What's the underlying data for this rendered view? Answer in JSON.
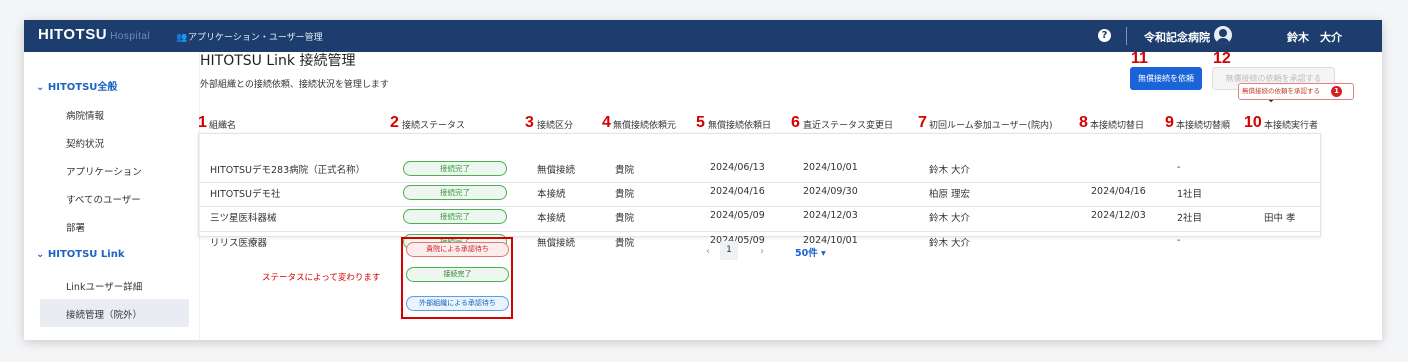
{
  "topbar": {
    "logo": "HITOTSU",
    "logo_sub": "Hospital",
    "nav_icon": "users-icon",
    "nav_label": "アプリケーション・ユーザー管理",
    "help": "?",
    "hospital": "令和記念病院",
    "user": "鈴木　大介"
  },
  "sidebar": {
    "section1": "HITOTSU全般",
    "items1": [
      "病院情報",
      "契約状況",
      "アプリケーション",
      "すべてのユーザー",
      "部署"
    ],
    "section2": "HITOTSU Link",
    "items2": [
      "Linkユーザー詳細",
      "接続管理（院外）"
    ]
  },
  "page": {
    "title": "HITOTSU Link 接続管理",
    "subtitle": "外部組織との接続依頼、接続状況を管理します",
    "btn_request": "無償接続を依頼",
    "btn_approve_disabled": "無償接続の依頼を承認する",
    "btn_approve": "無償接続の依頼を承認する",
    "approve_badge": "1"
  },
  "table": {
    "columns": [
      "組織名",
      "接続ステータス",
      "接続区分",
      "無償接続依頼元",
      "無償接続依頼日",
      "直近ステータス変更日",
      "初回ルーム参加ユーザー(院内)",
      "本接続切替日",
      "本接続切替順",
      "本接続実行者"
    ],
    "rows": [
      [
        "HITOTSUデモ283病院（正式名称）",
        "接続完了",
        "無償接続",
        "貴院",
        "2024/06/13",
        "2024/10/01",
        "鈴木 大介",
        "",
        "-",
        ""
      ],
      [
        "HITOTSUデモ社",
        "接続完了",
        "本接続",
        "貴院",
        "2024/04/16",
        "2024/09/30",
        "柏原 理宏",
        "2024/04/16",
        "1社目",
        ""
      ],
      [
        "三ツ星医科器械",
        "接続完了",
        "本接続",
        "貴院",
        "2024/05/09",
        "2024/12/03",
        "鈴木 大介",
        "2024/12/03",
        "2社目",
        "田中 孝"
      ],
      [
        "リリス医療器",
        "接続完了",
        "無償接続",
        "貴院",
        "2024/05/09",
        "2024/10/01",
        "鈴木 大介",
        "",
        "-",
        ""
      ]
    ]
  },
  "annotations": [
    "1",
    "2",
    "3",
    "4",
    "5",
    "6",
    "7",
    "8",
    "9",
    "10",
    "11",
    "12"
  ],
  "pager": {
    "prev": "‹",
    "page": "1",
    "next": "›",
    "size": "50件 ▾"
  },
  "legend": {
    "note": "ステータスによって変わります",
    "status_waiting_us": "貴院による承認待ち",
    "status_done": "接続完了",
    "status_waiting_ext": "外部組織による承認待ち"
  },
  "colors": {
    "topbar": "#1c3d6e",
    "accent": "#1a63d8",
    "annotation": "#d60000",
    "status_green": "#4caf50"
  }
}
